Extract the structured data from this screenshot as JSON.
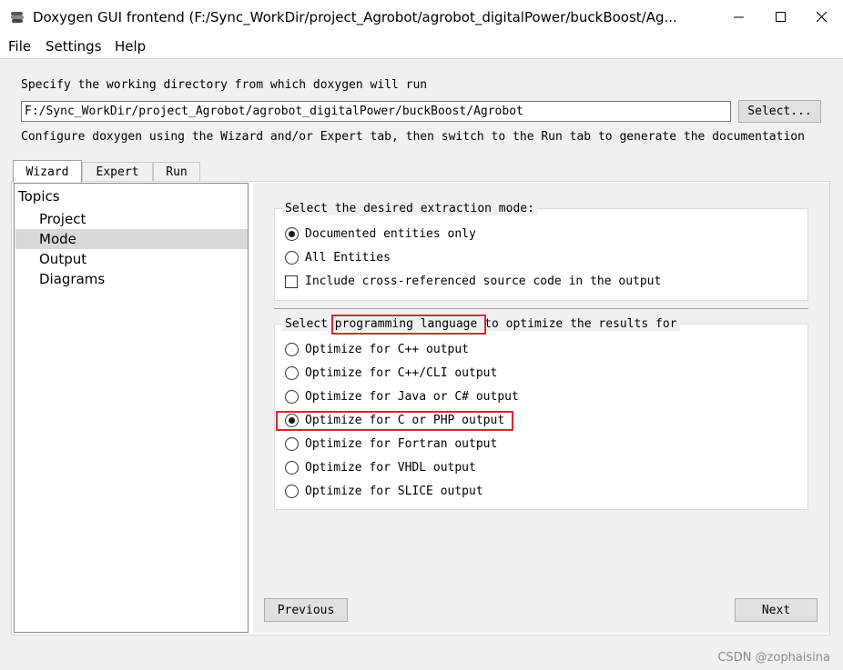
{
  "window": {
    "title": "Doxygen GUI frontend (F:/Sync_WorkDir/project_Agrobot/agrobot_digitalPower/buckBoost/Ag...",
    "icons": {
      "app": "doxygen-app-icon",
      "minimize": "minimize-icon",
      "maximize": "maximize-icon",
      "close": "close-icon"
    }
  },
  "menu": {
    "file": "File",
    "settings": "Settings",
    "help": "Help"
  },
  "workdir": {
    "prompt": "Specify the working directory from which doxygen will run",
    "value": "F:/Sync_WorkDir/project_Agrobot/agrobot_digitalPower/buckBoost/Agrobot",
    "select_label": "Select...",
    "hint": "Configure doxygen using the Wizard and/or Expert tab, then switch to the Run tab to generate the documentation"
  },
  "tabs": [
    {
      "label": "Wizard",
      "active": true
    },
    {
      "label": "Expert",
      "active": false
    },
    {
      "label": "Run",
      "active": false
    }
  ],
  "topics": {
    "header": "Topics",
    "items": [
      "Project",
      "Mode",
      "Output",
      "Diagrams"
    ],
    "selected": "Mode"
  },
  "extraction": {
    "title": "Select the desired extraction mode:",
    "options": [
      {
        "label": "Documented entities only",
        "selected": true
      },
      {
        "label": "All Entities",
        "selected": false
      }
    ],
    "crossref": {
      "label": "Include cross-referenced source code in the output",
      "checked": false
    }
  },
  "language": {
    "title_pre": "Select ",
    "title_highlight": "programming language",
    "title_post": " to optimize the results for",
    "options": [
      {
        "label": "Optimize for C++ output",
        "selected": false
      },
      {
        "label": "Optimize for C++/CLI output",
        "selected": false
      },
      {
        "label": "Optimize for Java or C# output",
        "selected": false
      },
      {
        "label": "Optimize for C or PHP output",
        "selected": true
      },
      {
        "label": "Optimize for Fortran output",
        "selected": false
      },
      {
        "label": "Optimize for VHDL output",
        "selected": false
      },
      {
        "label": "Optimize for SLICE output",
        "selected": false
      }
    ]
  },
  "nav": {
    "previous": "Previous",
    "next": "Next"
  },
  "watermark": "CSDN @zophaisina",
  "colors": {
    "highlight": "#e0242c",
    "selection": "#d9d9d9"
  }
}
